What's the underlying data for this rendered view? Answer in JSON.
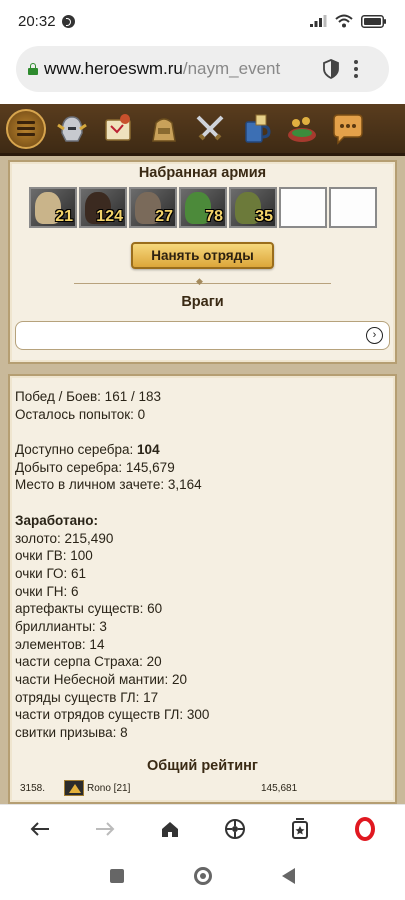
{
  "status_bar": {
    "time": "20:32"
  },
  "browser": {
    "url_main": "www.heroeswm.ru",
    "url_path": "/naym_event"
  },
  "game_nav": {
    "items": [
      "menu",
      "hero-helmet",
      "map-scroll",
      "inventory-bag",
      "battle-swords",
      "tavern-mug",
      "roulette",
      "chat"
    ]
  },
  "army": {
    "title": "Набранная армия",
    "slots": [
      {
        "count": "21",
        "color": "#c9b48a"
      },
      {
        "count": "124",
        "color": "#3b2a20"
      },
      {
        "count": "27",
        "color": "#7a6a5a"
      },
      {
        "count": "78",
        "color": "#4c8a3a"
      },
      {
        "count": "35",
        "color": "#6c7a3a"
      },
      {
        "count": ""
      },
      {
        "count": ""
      }
    ],
    "hire_button": "Нанять отряды"
  },
  "enemies": {
    "title": "Враги"
  },
  "stats": {
    "wins_label": "Побед / Боев: 161 / 183",
    "attempts_label": "Осталось попыток: 0",
    "silver_available_label": "Доступно серебра: ",
    "silver_available_value": "104",
    "silver_earned_label": "Добыто серебра: 145,679",
    "personal_rank_label": "Место в личном зачете: 3,164",
    "earned_title": "Заработано:",
    "earned_items": [
      "золото: 215,490",
      "очки ГВ: 100",
      "очки ГО: 61",
      "очки ГН: 6",
      "артефакты существ: 60",
      "бриллианты: 3",
      "элементов: 14",
      "части серпа Страха: 20",
      "части Небесной мантии: 20",
      "отряды существ ГЛ: 17",
      "части отрядов существ ГЛ: 300",
      "свитки призыва: 8"
    ]
  },
  "rating": {
    "title": "Общий рейтинг",
    "row": {
      "rank": "3158.",
      "player": "Rono [21]",
      "score": "145,681"
    }
  },
  "bottom_bar": {
    "items": [
      "back-arrow",
      "forward-arrow",
      "home",
      "speed-dial",
      "tabs",
      "opera-menu"
    ]
  }
}
